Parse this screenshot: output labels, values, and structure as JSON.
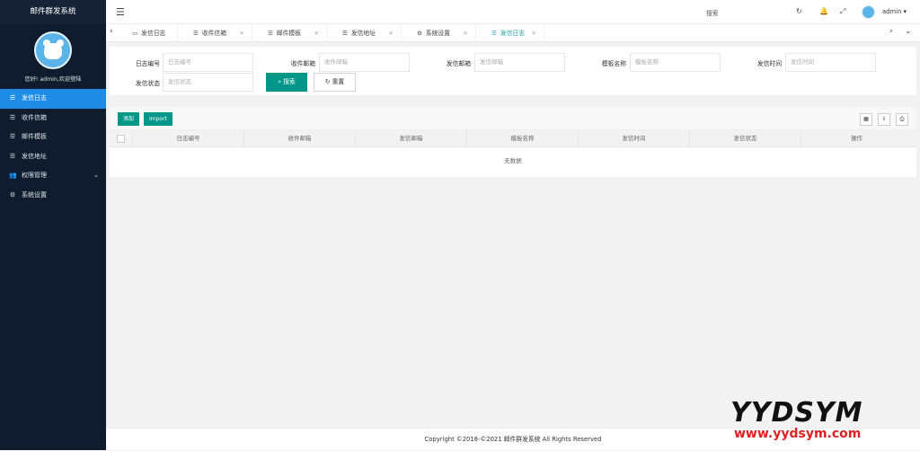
{
  "app": {
    "title": "邮件群发系统"
  },
  "user": {
    "welcome": "您好! admin,欢迎登陆",
    "name": "admin"
  },
  "sidebar": {
    "items": [
      {
        "label": "发信日志",
        "icon": "list-icon",
        "active": true
      },
      {
        "label": "收件信箱",
        "icon": "list-icon"
      },
      {
        "label": "邮件模板",
        "icon": "list-icon"
      },
      {
        "label": "发信地址",
        "icon": "list-icon"
      },
      {
        "label": "权限管理",
        "icon": "users-icon",
        "expandable": true
      },
      {
        "label": "系统设置",
        "icon": "gear-icon"
      }
    ]
  },
  "topbar": {
    "search_label": "搜索"
  },
  "tabs": [
    {
      "label": "发信日志",
      "icon": "monitor-icon"
    },
    {
      "label": "收件信箱",
      "icon": "list-icon"
    },
    {
      "label": "邮件模板",
      "icon": "list-icon"
    },
    {
      "label": "发信地址",
      "icon": "list-icon"
    },
    {
      "label": "系统设置",
      "icon": "gear-icon"
    },
    {
      "label": "发信日志",
      "icon": "list-icon",
      "active": true
    }
  ],
  "filters": {
    "log_id": {
      "label": "日志编号",
      "placeholder": "日志编号"
    },
    "recv_email": {
      "label": "收件邮箱",
      "placeholder": "收件邮箱"
    },
    "send_email": {
      "label": "发信邮箱",
      "placeholder": "发信邮箱"
    },
    "template_name": {
      "label": "模板名称",
      "placeholder": "模板名称"
    },
    "send_time": {
      "label": "发信时间",
      "placeholder": "发信时间"
    },
    "send_status": {
      "label": "发信状态",
      "placeholder": "发信状态"
    },
    "search_button": "搜索",
    "reset_button": "重置"
  },
  "table": {
    "add_button": "添加",
    "import_button": "Import",
    "columns": [
      "日志编号",
      "收件邮箱",
      "发信邮箱",
      "模板名称",
      "发信时间",
      "发信状态",
      "操作"
    ],
    "empty_text": "无数据"
  },
  "footer": {
    "copyright": "Copyright ©2018-©2021 邮件群发系统 All Rights Reserved"
  },
  "watermark": {
    "brand": "YYDSYM",
    "url": "www.yydsym.com"
  },
  "colors": {
    "sidebar_bg": "#0f1c2e",
    "active": "#1e8ce6",
    "primary": "#009688",
    "watermark_red": "#e02020"
  }
}
